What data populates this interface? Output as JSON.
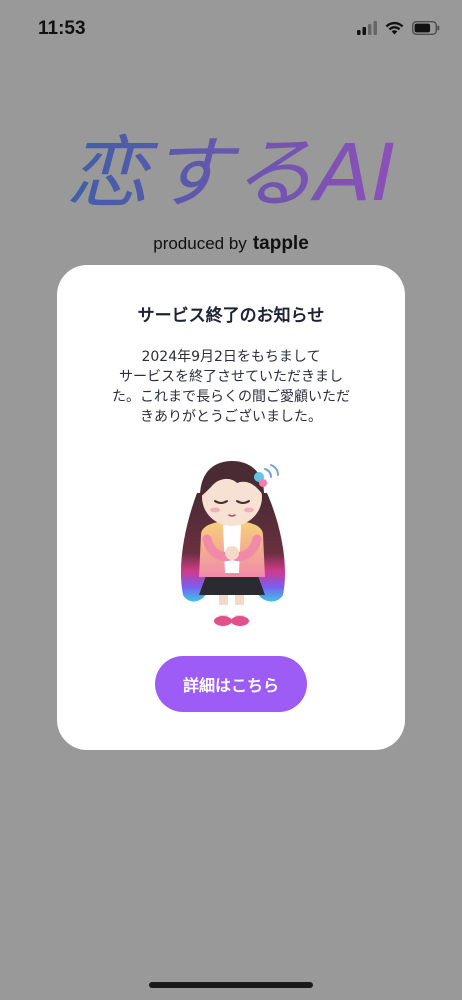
{
  "status_bar": {
    "time": "11:53"
  },
  "logo": {
    "title": "恋するAI",
    "produced_by": "produced by",
    "brand": "tapple"
  },
  "modal": {
    "title": "サービス終了のお知らせ",
    "body_lines": [
      "2024年9月2日をもちまして",
      "サービスを終了させていただきまし",
      "た。これまで長らくの間ご愛顧いただ",
      "きありがとうございました。"
    ],
    "button_label": "詳細はこちら",
    "button_color": "#9c5cf5"
  },
  "colors": {
    "overlay": "#999999",
    "logo_gradient_start": "#3f5fa6",
    "logo_gradient_end": "#8e4fb8"
  }
}
